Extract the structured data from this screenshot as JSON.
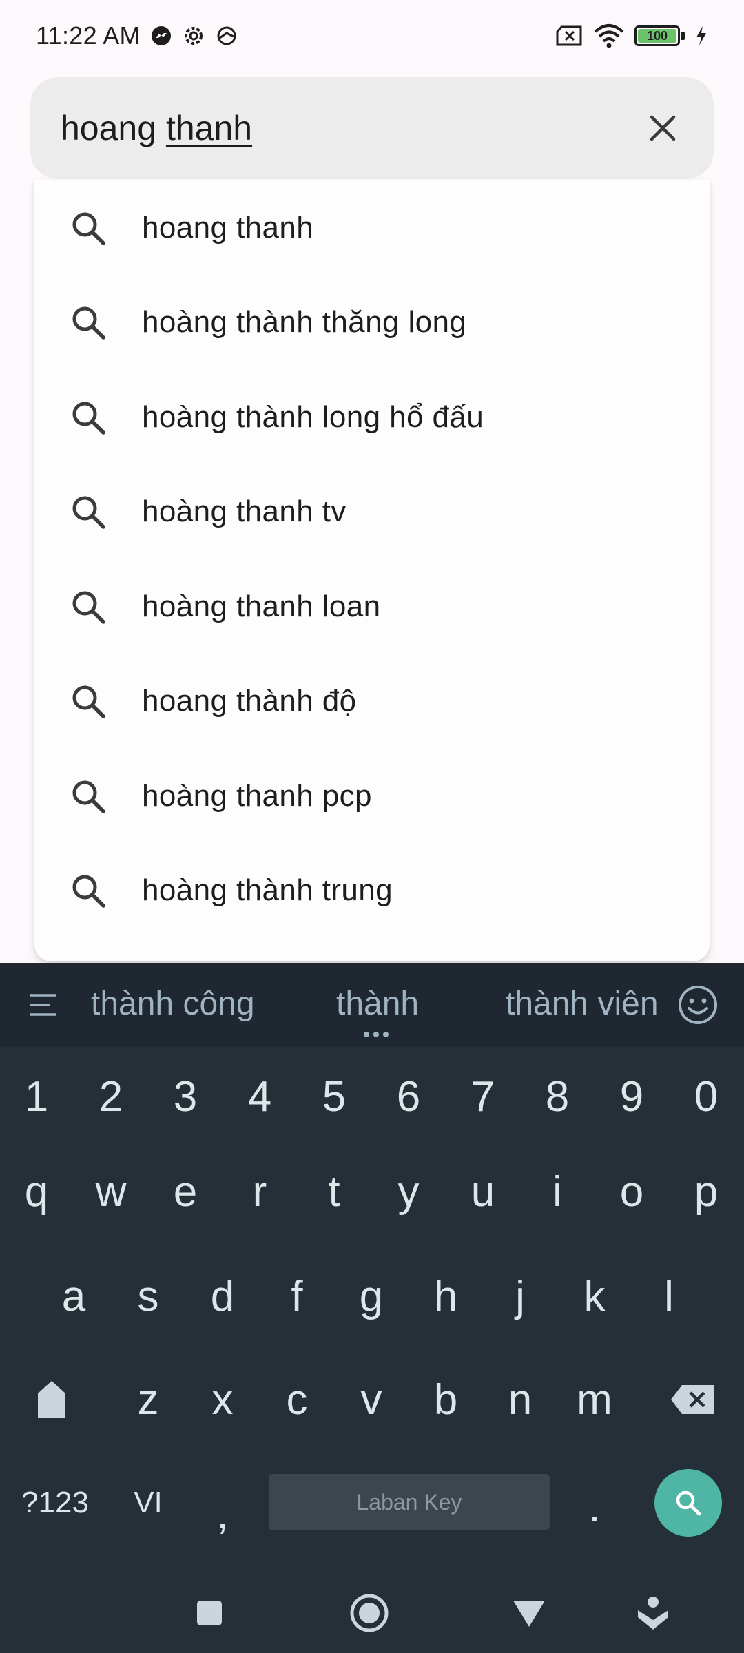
{
  "status_bar": {
    "time": "11:22 AM",
    "battery": "100",
    "left_icons": [
      "messenger-icon",
      "settings-gear-icon",
      "vpn-icon"
    ],
    "right_icons": [
      "no-sim-icon",
      "wifi-icon",
      "battery-icon",
      "charging-icon"
    ]
  },
  "search": {
    "query_first": "hoang ",
    "query_underlined": "thanh",
    "clear_icon": "close-icon"
  },
  "suggestions": [
    {
      "label": "hoang thanh"
    },
    {
      "label": "hoàng thành thăng long"
    },
    {
      "label": "hoàng thành long hổ đấu"
    },
    {
      "label": "hoàng thanh tv"
    },
    {
      "label": "hoàng thanh loan"
    },
    {
      "label": "hoang thành độ"
    },
    {
      "label": "hoàng thanh pcp"
    },
    {
      "label": "hoàng thành trung"
    }
  ],
  "keyboard": {
    "suggested_words": [
      "thành công",
      "thành",
      "thành viên"
    ],
    "number_row": [
      "1",
      "2",
      "3",
      "4",
      "5",
      "6",
      "7",
      "8",
      "9",
      "0"
    ],
    "row1": [
      "q",
      "w",
      "e",
      "r",
      "t",
      "y",
      "u",
      "i",
      "o",
      "p"
    ],
    "row2": [
      "a",
      "s",
      "d",
      "f",
      "g",
      "h",
      "j",
      "k",
      "l"
    ],
    "row3": [
      "z",
      "x",
      "c",
      "v",
      "b",
      "n",
      "m"
    ],
    "symbols_label": "?123",
    "language_label": "VI",
    "comma": ",",
    "space_label": "Laban Key",
    "period": ".",
    "colors": {
      "background": "#252f37",
      "accent": "#4fb6a6"
    }
  },
  "nav_bar": {
    "buttons": [
      "square-icon",
      "home-circle-icon",
      "back-triangle-icon",
      "keyboard-hide-icon"
    ]
  }
}
